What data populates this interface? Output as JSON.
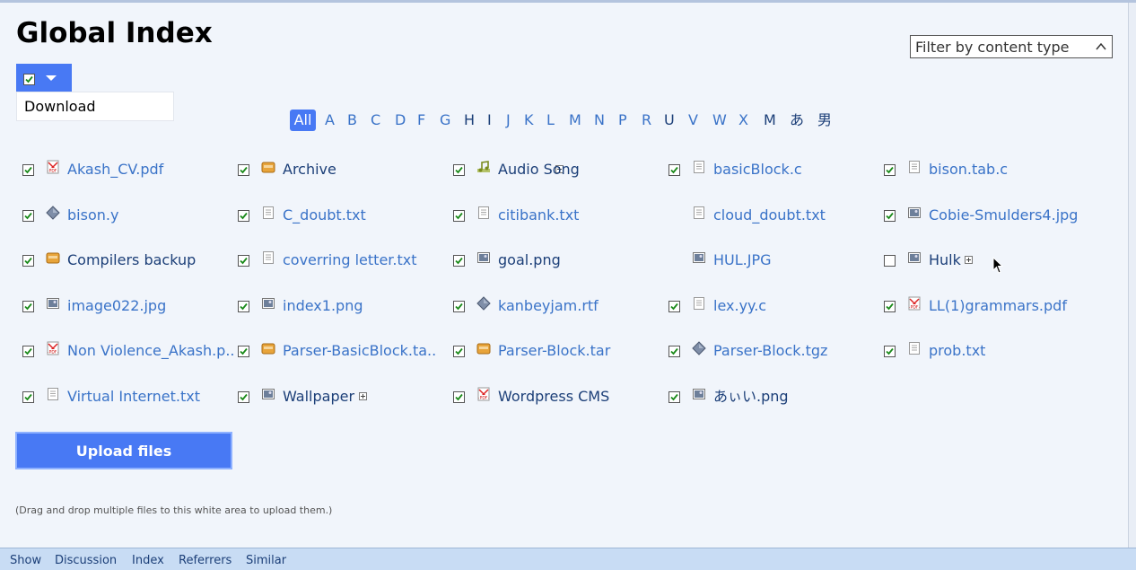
{
  "page": {
    "title": "Global Index"
  },
  "filter": {
    "label": "Filter by content type"
  },
  "bulk": {
    "menu_item": "Download"
  },
  "alphabet": [
    "All",
    "A",
    "B",
    "C",
    "D",
    "F",
    "G",
    "H",
    "I",
    "J",
    "K",
    "L",
    "M",
    "N",
    "P",
    "R",
    "U",
    "V",
    "W",
    "X",
    "M",
    "あ",
    "男"
  ],
  "alphabet_active": "All",
  "files": [
    {
      "name": "Akash_CV.pdf",
      "icon": "pdf-icon",
      "checked": true
    },
    {
      "name": "Archive",
      "icon": "folder-icon",
      "checked": true,
      "folder": true
    },
    {
      "name": "Audio Song",
      "icon": "music-icon",
      "checked": true,
      "folder": true
    },
    {
      "name": "basicBlock.c",
      "icon": "text-file-icon",
      "checked": true
    },
    {
      "name": "bison.tab.c",
      "icon": "text-file-icon",
      "checked": true
    },
    {
      "name": "bison.y",
      "icon": "generic-file-icon",
      "checked": true
    },
    {
      "name": "C_doubt.txt",
      "icon": "text-file-icon",
      "checked": true
    },
    {
      "name": "citibank.txt",
      "icon": "text-file-icon",
      "checked": true
    },
    {
      "name": "cloud_doubt.txt",
      "icon": "text-file-icon",
      "checked": null
    },
    {
      "name": "Cobie-Smulders4.jpg",
      "icon": "image-icon",
      "checked": true
    },
    {
      "name": "Compilers backup",
      "icon": "folder-icon",
      "checked": true,
      "folder": true
    },
    {
      "name": "coverring letter.txt",
      "icon": "text-file-icon",
      "checked": true
    },
    {
      "name": "goal.png",
      "icon": "image-icon",
      "checked": true,
      "folder": true
    },
    {
      "name": "HUL.JPG",
      "icon": "image-icon",
      "checked": null
    },
    {
      "name": "Hulk",
      "icon": "image-icon",
      "checked": false,
      "folder": true
    },
    {
      "name": "image022.jpg",
      "icon": "image-icon",
      "checked": true
    },
    {
      "name": "index1.png",
      "icon": "image-icon",
      "checked": true
    },
    {
      "name": "kanbeyjam.rtf",
      "icon": "generic-file-icon",
      "checked": true
    },
    {
      "name": "lex.yy.c",
      "icon": "text-file-icon",
      "checked": true
    },
    {
      "name": "LL(1)grammars.pdf",
      "icon": "pdf-icon",
      "checked": true
    },
    {
      "name": "Non Violence_Akash.p..",
      "icon": "pdf-icon",
      "checked": true
    },
    {
      "name": "Parser-BasicBlock.ta..",
      "icon": "folder-icon",
      "checked": true
    },
    {
      "name": "Parser-Block.tar",
      "icon": "folder-icon",
      "checked": true
    },
    {
      "name": "Parser-Block.tgz",
      "icon": "generic-file-icon",
      "checked": true
    },
    {
      "name": "prob.txt",
      "icon": "text-file-icon",
      "checked": true
    },
    {
      "name": "Virtual Internet.txt",
      "icon": "text-file-icon",
      "checked": true
    },
    {
      "name": "Wallpaper",
      "icon": "image-icon",
      "checked": true,
      "folder": true
    },
    {
      "name": "Wordpress CMS",
      "icon": "pdf-icon",
      "checked": true,
      "folder": true
    },
    {
      "name": "あぃい.png",
      "icon": "image-icon",
      "checked": true,
      "folder": true
    }
  ],
  "upload": {
    "label": "Upload files",
    "hint": "(Drag and drop multiple files to this white area to upload them.)"
  },
  "footer": {
    "links": [
      "Show",
      "Discussion",
      "Index",
      "Referrers",
      "Similar"
    ]
  },
  "colors": {
    "accent": "#4879f4",
    "link": "#3a73c8",
    "link_dark": "#1c3f78",
    "footer_bg": "#c8dcf4"
  }
}
